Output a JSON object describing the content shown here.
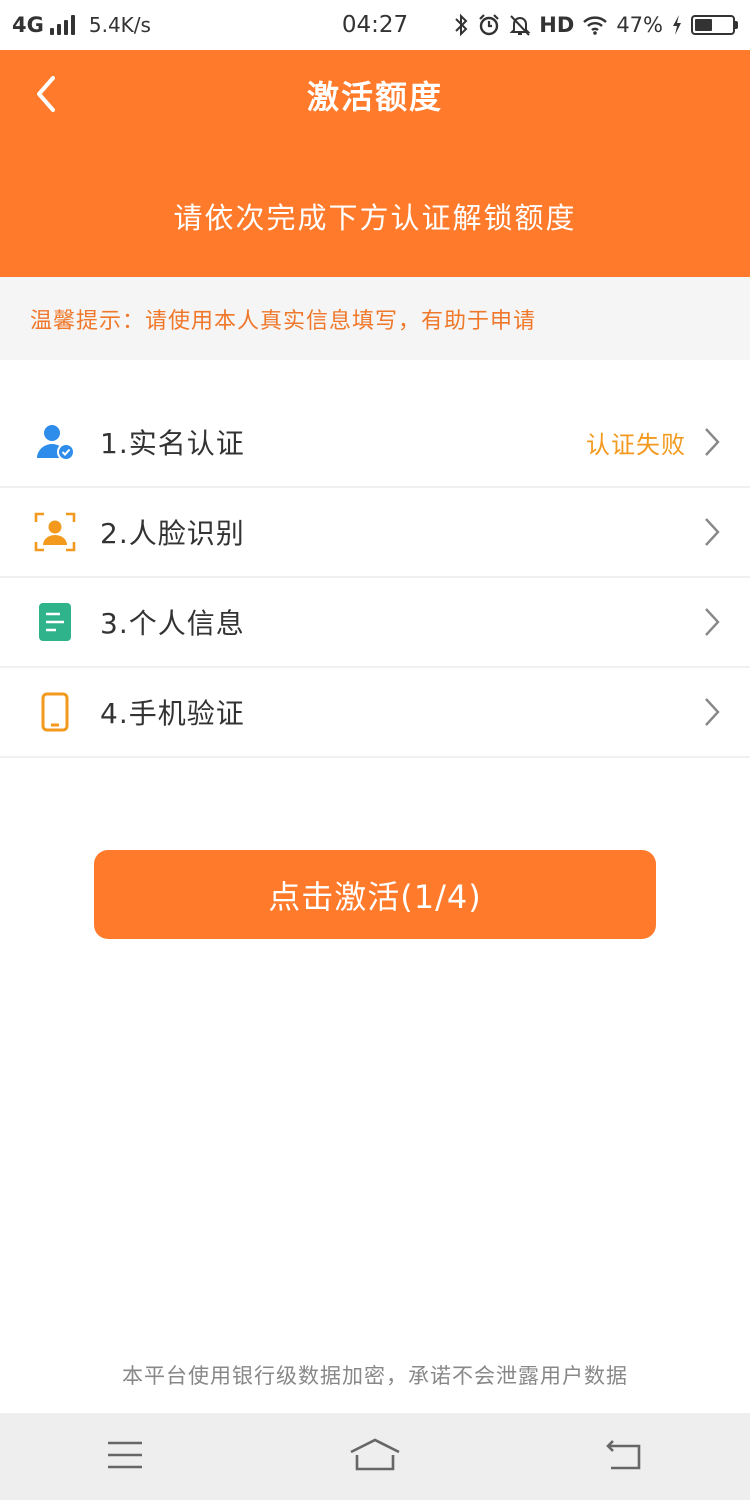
{
  "status_bar": {
    "network": "4G",
    "speed": "5.4K/s",
    "time": "04:27",
    "hd": "HD",
    "battery_percent": "47%",
    "battery_level": 0.47
  },
  "header": {
    "title": "激活额度",
    "subtitle": "请依次完成下方认证解锁额度",
    "background_color": "#FF7A2A"
  },
  "tip": {
    "text": "温馨提示：请使用本人真实信息填写，有助于申请"
  },
  "steps": [
    {
      "label": "1.实名认证",
      "status": "认证失败",
      "icon": "user-verified-icon",
      "icon_color": "#2E8CEB"
    },
    {
      "label": "2.人脸识别",
      "status": "",
      "icon": "face-scan-icon",
      "icon_color": "#F39A1E"
    },
    {
      "label": "3.个人信息",
      "status": "",
      "icon": "document-icon",
      "icon_color": "#2FB38A"
    },
    {
      "label": "4.手机验证",
      "status": "",
      "icon": "phone-icon",
      "icon_color": "#F39A1E"
    }
  ],
  "activate_button": {
    "label": "点击激活(1/4)"
  },
  "footer": {
    "note": "本平台使用银行级数据加密，承诺不会泄露用户数据"
  },
  "colors": {
    "accent": "#FF7A2A",
    "status_fail": "#F39A1E",
    "tip_text": "#F0782A"
  }
}
